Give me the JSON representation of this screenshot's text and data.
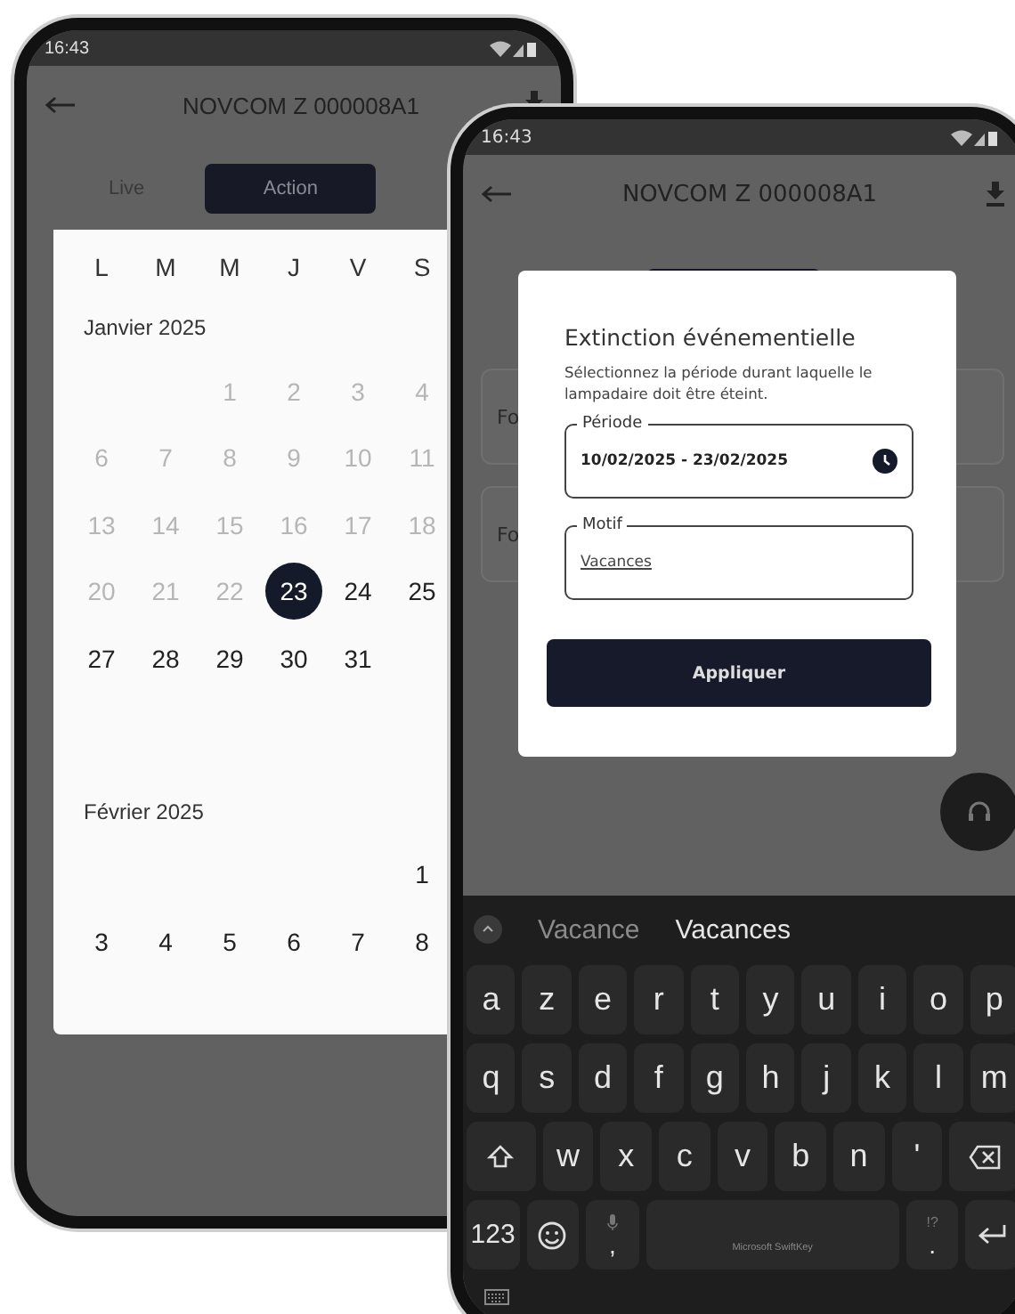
{
  "back_phone": {
    "status_time": "16:43",
    "title": "NOVCOM Z 000008A1",
    "tabs": [
      {
        "label": "Live",
        "selected": false
      },
      {
        "label": "Action",
        "selected": true
      }
    ],
    "weekdays": [
      "L",
      "M",
      "M",
      "J",
      "V",
      "S"
    ],
    "months": [
      {
        "title": "Janvier 2025",
        "weeks": [
          [
            {
              "day": "1",
              "disabled": true,
              "selected": false
            },
            {
              "day": "2",
              "disabled": true,
              "selected": false
            },
            {
              "day": "3",
              "disabled": true,
              "selected": false
            },
            {
              "day": "4",
              "disabled": true,
              "selected": false
            }
          ],
          [
            {
              "day": "6",
              "disabled": true,
              "selected": false
            },
            {
              "day": "7",
              "disabled": true,
              "selected": false
            },
            {
              "day": "8",
              "disabled": true,
              "selected": false
            },
            {
              "day": "9",
              "disabled": true,
              "selected": false
            },
            {
              "day": "10",
              "disabled": true,
              "selected": false
            },
            {
              "day": "11",
              "disabled": true,
              "selected": false
            }
          ],
          [
            {
              "day": "13",
              "disabled": true,
              "selected": false
            },
            {
              "day": "14",
              "disabled": true,
              "selected": false
            },
            {
              "day": "15",
              "disabled": true,
              "selected": false
            },
            {
              "day": "16",
              "disabled": true,
              "selected": false
            },
            {
              "day": "17",
              "disabled": true,
              "selected": false
            },
            {
              "day": "18",
              "disabled": true,
              "selected": false
            }
          ],
          [
            {
              "day": "20",
              "disabled": true,
              "selected": false
            },
            {
              "day": "21",
              "disabled": true,
              "selected": false
            },
            {
              "day": "22",
              "disabled": true,
              "selected": false
            },
            {
              "day": "23",
              "disabled": false,
              "selected": true
            },
            {
              "day": "24",
              "disabled": false,
              "selected": false
            },
            {
              "day": "25",
              "disabled": false,
              "selected": false
            }
          ],
          [
            {
              "day": "27",
              "disabled": false,
              "selected": false
            },
            {
              "day": "28",
              "disabled": false,
              "selected": false
            },
            {
              "day": "29",
              "disabled": false,
              "selected": false
            },
            {
              "day": "30",
              "disabled": false,
              "selected": false
            },
            {
              "day": "31",
              "disabled": false,
              "selected": false
            }
          ]
        ]
      },
      {
        "title": "Février 2025",
        "weeks": [
          [
            {
              "day": "1",
              "disabled": false,
              "selected": false
            }
          ],
          [
            {
              "day": "3",
              "disabled": false,
              "selected": false
            },
            {
              "day": "4",
              "disabled": false,
              "selected": false
            },
            {
              "day": "5",
              "disabled": false,
              "selected": false
            },
            {
              "day": "6",
              "disabled": false,
              "selected": false
            },
            {
              "day": "7",
              "disabled": false,
              "selected": false
            },
            {
              "day": "8",
              "disabled": false,
              "selected": false
            }
          ]
        ]
      }
    ]
  },
  "front_phone": {
    "status_time": "16:43",
    "title": "NOVCOM Z 000008A1",
    "cards": [
      {
        "label": "Fo"
      },
      {
        "label": "Fo"
      }
    ],
    "dialog": {
      "title": "Extinction événementielle",
      "description": "Sélectionnez la période durant laquelle le lampadaire doit être éteint.",
      "fields": [
        {
          "kind": "date",
          "label": "Période",
          "value": "10/02/2025 - 23/02/2025"
        },
        {
          "kind": "text",
          "label": "Motif",
          "value": "Vacances"
        }
      ],
      "button": "Appliquer"
    },
    "keyboard": {
      "suggestions": [
        {
          "text": "Vacance",
          "selected": false
        },
        {
          "text": "Vacances",
          "selected": true
        }
      ],
      "top_keys": [
        {
          "kind": "char",
          "label": "a"
        },
        {
          "kind": "char",
          "label": "z"
        },
        {
          "kind": "char",
          "label": "e"
        },
        {
          "kind": "char",
          "label": "r"
        },
        {
          "kind": "char",
          "label": "t"
        },
        {
          "kind": "char",
          "label": "y"
        },
        {
          "kind": "char",
          "label": "u"
        },
        {
          "kind": "char",
          "label": "i"
        },
        {
          "kind": "char",
          "label": "o"
        },
        {
          "kind": "char",
          "label": "p"
        }
      ],
      "home_keys": [
        {
          "kind": "char",
          "label": "q"
        },
        {
          "kind": "char",
          "label": "s"
        },
        {
          "kind": "char",
          "label": "d"
        },
        {
          "kind": "char",
          "label": "f"
        },
        {
          "kind": "char",
          "label": "g"
        },
        {
          "kind": "char",
          "label": "h"
        },
        {
          "kind": "char",
          "label": "j"
        },
        {
          "kind": "char",
          "label": "k"
        },
        {
          "kind": "char",
          "label": "l"
        },
        {
          "kind": "char",
          "label": "m"
        }
      ],
      "lower_keys": [
        {
          "kind": "shift"
        },
        {
          "kind": "char",
          "label": "w"
        },
        {
          "kind": "char",
          "label": "x"
        },
        {
          "kind": "char",
          "label": "c"
        },
        {
          "kind": "char",
          "label": "v"
        },
        {
          "kind": "char",
          "label": "b"
        },
        {
          "kind": "char",
          "label": "n"
        },
        {
          "kind": "char",
          "label": "'"
        },
        {
          "kind": "backspace"
        }
      ],
      "function_keys": [
        {
          "kind": "mode",
          "label": "123"
        },
        {
          "kind": "emoji"
        },
        {
          "kind": "mic",
          "label": ","
        },
        {
          "kind": "space",
          "label": "Microsoft SwiftKey"
        },
        {
          "kind": "punct",
          "label": ".",
          "hint": "!?"
        },
        {
          "kind": "enter"
        }
      ]
    }
  }
}
